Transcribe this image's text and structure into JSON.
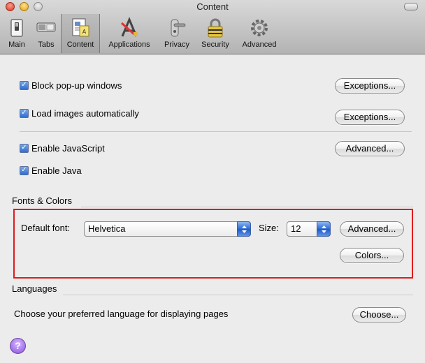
{
  "window": {
    "title": "Content"
  },
  "toolbar": {
    "items": [
      {
        "label": "Main",
        "icon": "switch-icon"
      },
      {
        "label": "Tabs",
        "icon": "tabs-icon"
      },
      {
        "label": "Content",
        "icon": "document-icon",
        "selected": true
      },
      {
        "label": "Applications",
        "icon": "applications-icon"
      },
      {
        "label": "Privacy",
        "icon": "door-handle-icon"
      },
      {
        "label": "Security",
        "icon": "lock-icon"
      },
      {
        "label": "Advanced",
        "icon": "gear-icon"
      }
    ]
  },
  "content": {
    "block_popups": {
      "label": "Block pop-up windows",
      "checked": true,
      "button": "Exceptions..."
    },
    "load_images": {
      "label": "Load images automatically",
      "checked": true,
      "button": "Exceptions..."
    },
    "enable_js": {
      "label": "Enable JavaScript",
      "checked": true,
      "button": "Advanced..."
    },
    "enable_java": {
      "label": "Enable Java",
      "checked": true
    }
  },
  "fonts_colors": {
    "title": "Fonts & Colors",
    "default_font_label": "Default font:",
    "default_font_value": "Helvetica",
    "size_label": "Size:",
    "size_value": "12",
    "advanced_button": "Advanced...",
    "colors_button": "Colors..."
  },
  "languages": {
    "title": "Languages",
    "description": "Choose your preferred language for displaying pages",
    "choose_button": "Choose..."
  },
  "help": {
    "label": "?"
  },
  "colors": {
    "highlight": "#e21b1b",
    "accent": "#2f6fcf"
  }
}
